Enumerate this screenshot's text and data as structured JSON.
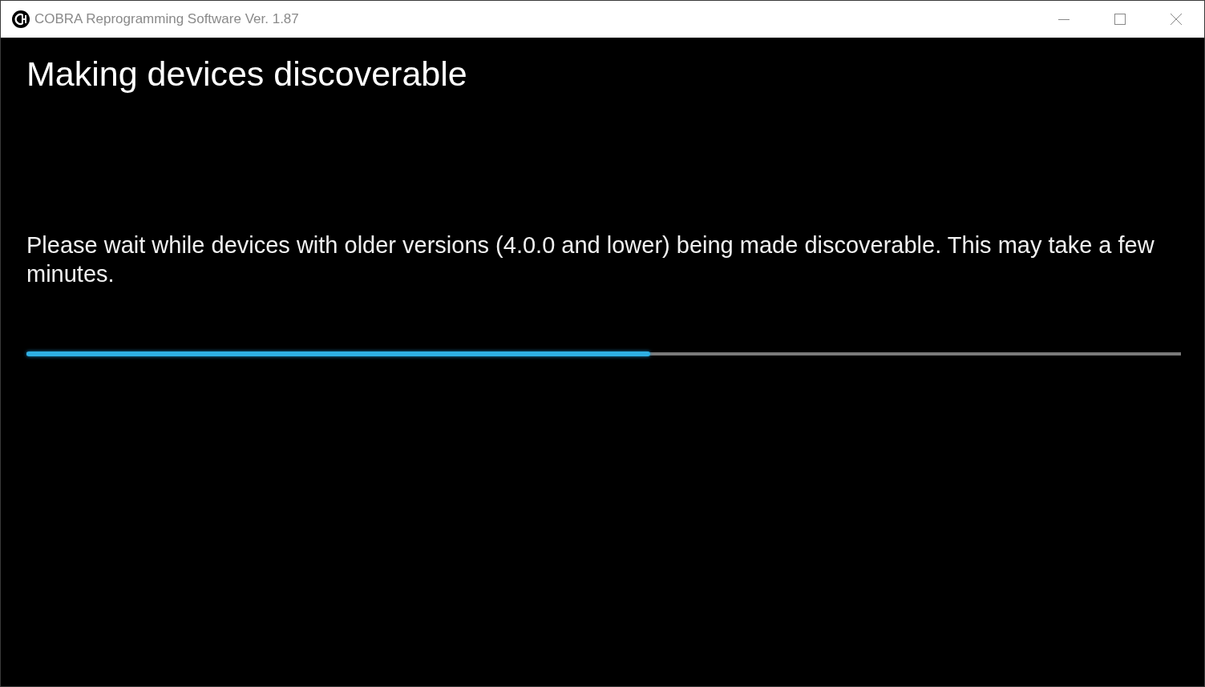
{
  "window": {
    "title": "COBRA Reprogramming Software Ver. 1.87"
  },
  "heading": "Making devices discoverable",
  "message": "Please wait while devices with older versions (4.0.0 and lower) being made discoverable. This may take a few minutes.",
  "progress": {
    "level": 0.54
  }
}
